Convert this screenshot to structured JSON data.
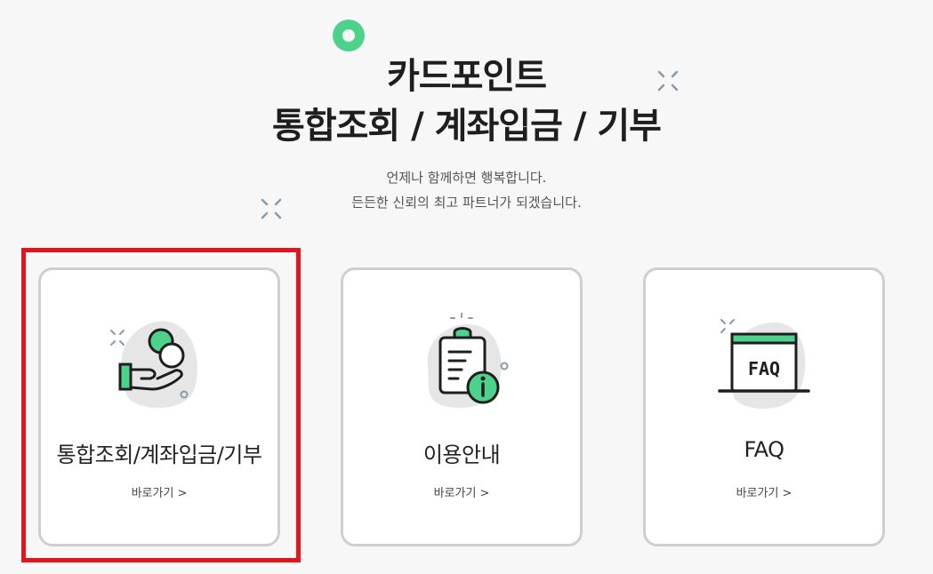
{
  "header": {
    "title_line1": "카드포인트",
    "title_line2": "통합조회 / 계좌입금 / 기부",
    "subtitle_line1": "언제나 함께하면 행복합니다.",
    "subtitle_line2": "든든한 신뢰의 최고 파트너가 되겠습니다."
  },
  "cards": [
    {
      "label": "통합조회/계좌입금/기부",
      "link": "바로가기 >",
      "icon": "hand-coins-icon",
      "selected": true
    },
    {
      "label": "이용안내",
      "link": "바로가기 >",
      "icon": "clipboard-info-icon",
      "selected": false
    },
    {
      "label": "FAQ",
      "link": "바로가기 >",
      "icon": "faq-window-icon",
      "selected": false
    }
  ],
  "colors": {
    "accent": "#4dd28c",
    "highlight": "#e3141b",
    "card_border": "#cfcfcf",
    "background": "#f7f7f7"
  }
}
